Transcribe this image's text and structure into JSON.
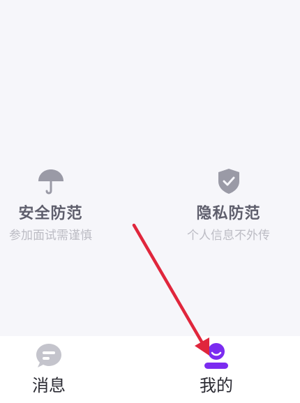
{
  "features": [
    {
      "icon": "umbrella-icon",
      "title": "安全防范",
      "description": "参加面试需谨慎"
    },
    {
      "icon": "shield-check-icon",
      "title": "隐私防范",
      "description": "个人信息不外传"
    }
  ],
  "tabbar": {
    "tabs": [
      {
        "icon": "message-bubble-icon",
        "label": "消息",
        "active": false
      },
      {
        "icon": "profile-icon",
        "label": "我的",
        "active": true
      }
    ]
  },
  "colors": {
    "background": "#f6f6fa",
    "feature_icon": "#9a9aa6",
    "title": "#5e5e6c",
    "description": "#bcbcc4",
    "active_tab": "#7b2cf0",
    "inactive_tab_icon": "#c4c4cc",
    "annotation_arrow": "#e0263c"
  }
}
